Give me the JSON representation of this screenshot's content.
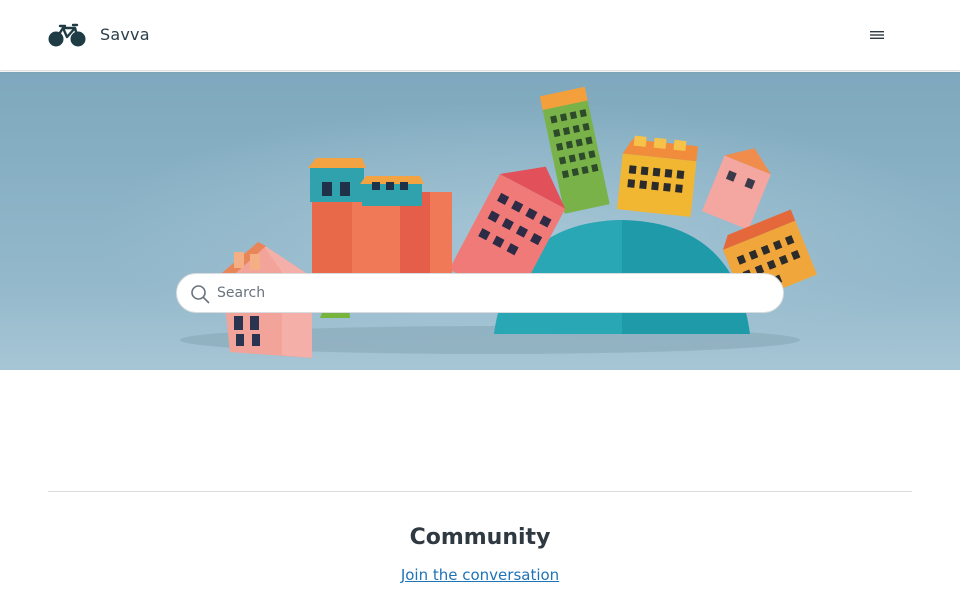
{
  "header": {
    "brand_name": "Savva",
    "logo_icon": "bicycle-icon",
    "menu_icon": "hamburger-menu-icon"
  },
  "hero": {
    "search": {
      "placeholder": "Search",
      "icon": "search-icon"
    },
    "background_color": "#8fb6c9"
  },
  "community": {
    "title": "Community",
    "link_label": "Join the conversation"
  },
  "colors": {
    "brand_dark": "#1f3c44",
    "link": "#1f73b7",
    "divider": "#d8dcde"
  }
}
